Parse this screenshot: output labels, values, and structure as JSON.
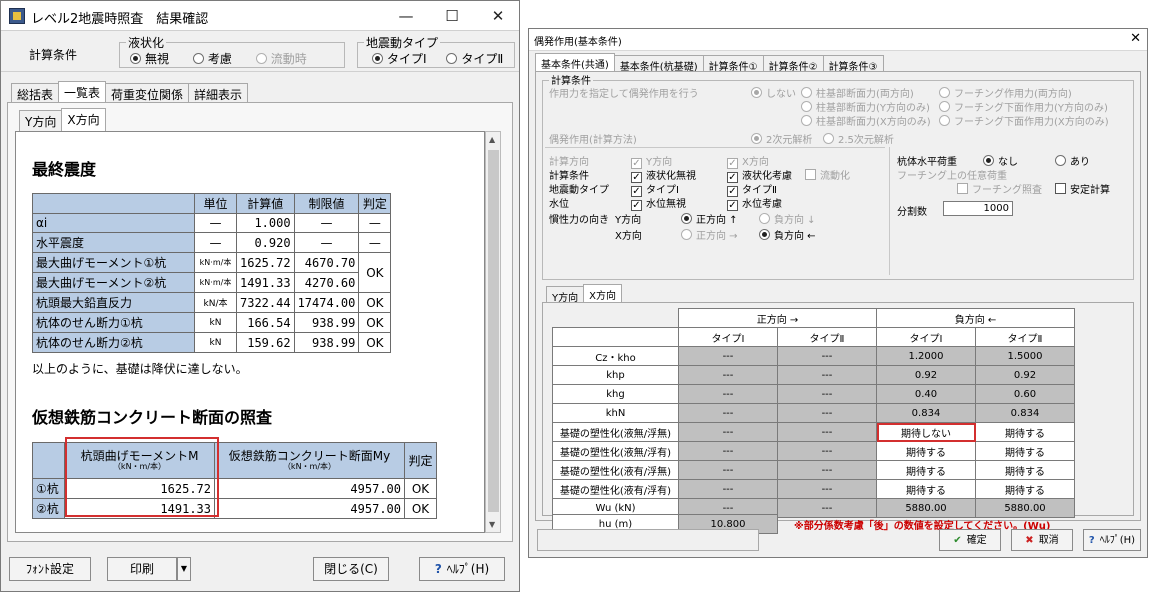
{
  "left_window": {
    "title": "レベル2地震時照査　結果確認",
    "min_glyph": "—",
    "max_glyph": "☐",
    "close_glyph": "✕",
    "calc_label": "計算条件",
    "liquefaction": {
      "title": "液状化",
      "opt_none": "無視",
      "opt_consider": "考慮",
      "opt_flow": "流動時"
    },
    "ground_motion": {
      "title": "地震動タイプ",
      "opt_1": "タイプⅠ",
      "opt_2": "タイプⅡ"
    },
    "tabs": [
      "総括表",
      "一覧表",
      "荷重変位関係",
      "詳細表示"
    ],
    "dir_tabs": [
      "Y方向",
      "X方向"
    ],
    "section1": {
      "title": "最終震度",
      "headers": [
        "単位",
        "計算値",
        "制限値",
        "判定"
      ],
      "rows": [
        {
          "label": "αi",
          "unit": "—",
          "calc": "1.000",
          "limit": "—",
          "judge": "—"
        },
        {
          "label": "水平震度",
          "unit": "—",
          "calc": "0.920",
          "limit": "—",
          "judge": "—"
        },
        {
          "label": "最大曲げモーメント①杭",
          "unit": "kN·m/本",
          "calc": "1625.72",
          "limit": "4670.70",
          "judge": ""
        },
        {
          "label": "最大曲げモーメント②杭",
          "unit": "kN·m/本",
          "calc": "1491.33",
          "limit": "4270.60",
          "judge": ""
        },
        {
          "label": "杭頭最大鉛直反力",
          "unit": "kN/本",
          "calc": "7322.44",
          "limit": "17474.00",
          "judge": "OK"
        },
        {
          "label": "杭体のせん断力①杭",
          "unit": "kN",
          "calc": "166.54",
          "limit": "938.99",
          "judge": "OK"
        },
        {
          "label": "杭体のせん断力②杭",
          "unit": "kN",
          "calc": "159.62",
          "limit": "938.99",
          "judge": "OK"
        }
      ],
      "merged_judge": "OK",
      "note": "以上のように、基礎は降伏に達しない。"
    },
    "section2": {
      "title": "仮想鉄筋コンクリート断面の照査",
      "h1": "杭頭曲げモーメントM",
      "h1_unit": "（kN・m/本）",
      "h2": "仮想鉄筋コンクリート断面My",
      "h2_unit": "（kN・m/本）",
      "h3": "判定",
      "rows": [
        {
          "label": "①杭",
          "m": "1625.72",
          "my": "4957.00",
          "judge": "OK"
        },
        {
          "label": "②杭",
          "m": "1491.33",
          "my": "4957.00",
          "judge": "OK"
        }
      ]
    },
    "buttons": {
      "font": "ﾌｫﾝﾄ設定",
      "print": "印刷",
      "close": "閉じる(C)",
      "help": "ﾍﾙﾌﾟ(H)"
    }
  },
  "right_window": {
    "title": "偶発作用(基本条件)",
    "close_glyph": "✕",
    "tabs": [
      "基本条件(共通)",
      "基本条件(杭基礎)",
      "計算条件①",
      "計算条件②",
      "計算条件③"
    ],
    "calc_group": "計算条件",
    "row1_label": "作用力を指定して偶発作用を行う",
    "opt_no": "しない",
    "col_opts": [
      "柱基部断面力(両方向)",
      "柱基部断面力(Y方向のみ)",
      "柱基部断面力(X方向のみ)"
    ],
    "foot_opts": [
      "フーチング作用力(両方向)",
      "フーチング下面作用力(Y方向のみ)",
      "フーチング下面作用力(X方向のみ)"
    ],
    "method_label": "偶発作用(計算方法)",
    "method_opts": [
      "2次元解析",
      "2.5次元解析"
    ],
    "calc_dir": "計算方向",
    "dir_y": "Y方向",
    "dir_x": "X方向",
    "rows": {
      "cond": "計算条件",
      "cond_y": "液状化無視",
      "cond_x": "液状化考慮",
      "cond_flow": "流動化",
      "motion": "地震動タイプ",
      "motion_y": "タイプⅠ",
      "motion_x": "タイプⅡ",
      "water": "水位",
      "water_y": "水位無視",
      "water_x": "水位考慮",
      "inertia": "慣性力の向き",
      "iy": "Y方向",
      "ix": "X方向",
      "pos": "正方向 ↑",
      "neg": "負方向 ↓",
      "pos_x": "正方向 →",
      "neg_x": "負方向 ←"
    },
    "pile_h_load": "杭体水平荷重",
    "opt_none": "なし",
    "opt_yes": "あり",
    "footing_load": "フーチング上の任意荷重",
    "footing_check": "フーチング照査",
    "stable_calc": "安定計算",
    "division": "分割数",
    "division_value": "1000",
    "dir_tabs": [
      "Y方向",
      "X方向"
    ],
    "grid": {
      "pos_header": "正方向 →",
      "neg_header": "負方向 ←",
      "types": [
        "タイプⅠ",
        "タイプⅡ",
        "タイプⅠ",
        "タイプⅡ"
      ],
      "rows": [
        {
          "label": "Cz・kho",
          "v": [
            "---",
            "---",
            "1.2000",
            "1.5000"
          ]
        },
        {
          "label": "khp",
          "v": [
            "---",
            "---",
            "0.92",
            "0.92"
          ]
        },
        {
          "label": "khg",
          "v": [
            "---",
            "---",
            "0.40",
            "0.60"
          ]
        },
        {
          "label": "khN",
          "v": [
            "---",
            "---",
            "0.834",
            "0.834"
          ]
        },
        {
          "label": "基礎の塑性化(液無/浮無)",
          "v": [
            "---",
            "---",
            "期待しない",
            "期待する"
          ]
        },
        {
          "label": "基礎の塑性化(液無/浮有)",
          "v": [
            "---",
            "---",
            "期待する",
            "期待する"
          ]
        },
        {
          "label": "基礎の塑性化(液有/浮無)",
          "v": [
            "---",
            "---",
            "期待する",
            "期待する"
          ]
        },
        {
          "label": "基礎の塑性化(液有/浮有)",
          "v": [
            "---",
            "---",
            "期待する",
            "期待する"
          ]
        },
        {
          "label": "Wu (kN)",
          "v": [
            "---",
            "---",
            "5880.00",
            "5880.00"
          ]
        }
      ],
      "hu_label": "hu (m)",
      "hu_value": "10.800",
      "hu_note": "※部分係数考慮「後」の数値を設定してください。(Wu)"
    },
    "buttons": {
      "ok": "確定",
      "cancel": "取消",
      "help": "ﾍﾙﾌﾟ(H)"
    },
    "colors": {
      "ok": "#2e8b2e",
      "cancel": "#cc2222",
      "help": "#2255aa",
      "note": "#cc0000"
    }
  }
}
